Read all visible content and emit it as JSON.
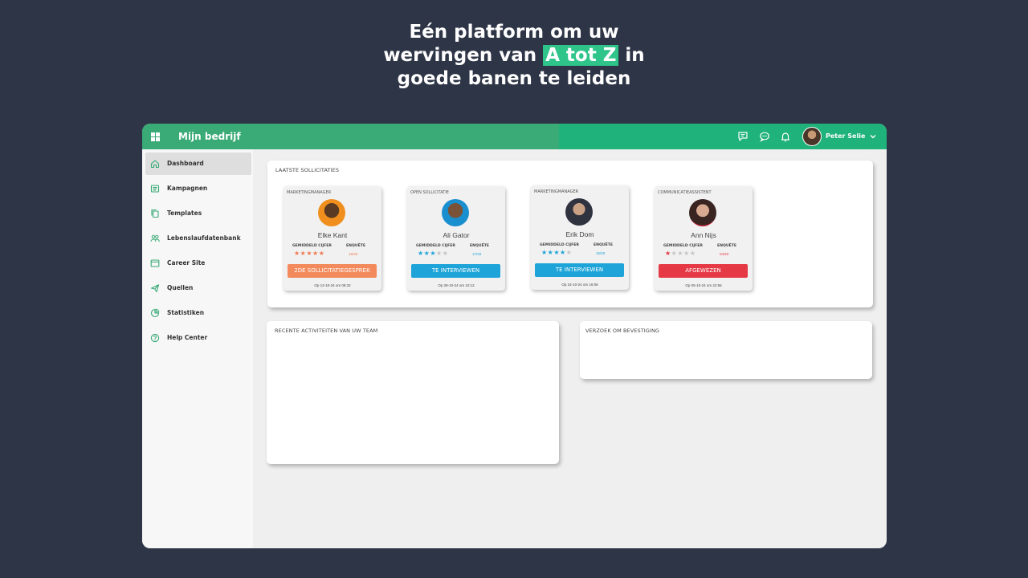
{
  "headline": {
    "line1": "Eén platform om uw",
    "line2_pre": "wervingen van",
    "line2_highlight": "A tot Z",
    "line2_post": "in",
    "line3": "goede banen te leiden",
    "highlight_color": "#2ec48a"
  },
  "topbar": {
    "brand": "Mijn bedrijf",
    "user_name": "Peter Selie",
    "icons": [
      "message-square-icon",
      "chat-bubble-icon",
      "bell-icon",
      "chevron-down-icon"
    ],
    "color": "#3aaa76"
  },
  "sidebar": {
    "items": [
      {
        "label": "Dashboard",
        "icon": "home-icon",
        "active": true
      },
      {
        "label": "Kampagnen",
        "icon": "list-icon"
      },
      {
        "label": "Templates",
        "icon": "copy-icon"
      },
      {
        "label": "Lebenslaufdatenbank",
        "icon": "users-icon"
      },
      {
        "label": "Career Site",
        "icon": "browser-icon"
      },
      {
        "label": "Quellen",
        "icon": "send-icon"
      },
      {
        "label": "Statistiken",
        "icon": "pie-chart-icon"
      },
      {
        "label": "Help Center",
        "icon": "help-circle-icon"
      }
    ]
  },
  "applications": {
    "title": "LAATSTE SOLLICITATIES",
    "col_rating": "GEMIDDELD CIJFER",
    "col_survey": "ENQUÊTE",
    "cards": [
      {
        "role": "MARKETINGMANAGER",
        "name": "Elke Kant",
        "stars": 5,
        "star_color": "#ef7a52",
        "score": "15/20",
        "score_color": "#ef7a52",
        "status": "2DE SOLLICITATIEGESPREK",
        "status_color": "#f28a5c",
        "date": "Op 12-10-24 om 08:32"
      },
      {
        "role": "OPEN SOLLICITATIE",
        "name": "Ali Gator",
        "stars": 3,
        "star_color": "#1ea4d8",
        "score": "17/20",
        "score_color": "#1ea4d8",
        "status": "TE INTERVIEWEN",
        "status_color": "#1ea4d8",
        "date": "Op 28-10-24 om 10:12"
      },
      {
        "role": "MARKETINGMANAGER",
        "name": "Erik Dom",
        "stars": 4,
        "star_color": "#1ea4d8",
        "score": "15/20",
        "score_color": "#1ea4d8",
        "status": "TE INTERVIEWEN",
        "status_color": "#1ea4d8",
        "date": "Op 24-10-24 om 16:06"
      },
      {
        "role": "COMMUNICATIEASSISTENT",
        "name": "Ann Nijs",
        "stars": 1,
        "star_color": "#e53945",
        "score": "04/20",
        "score_color": "#e53945",
        "status": "AFGEWEZEN",
        "status_color": "#e53945",
        "date": "Op 05-10-24 om 22:56"
      }
    ]
  },
  "activities": {
    "title": "RECENTE ACTIVITEITEN VAN UW TEAM"
  },
  "confirmation": {
    "title": "VERZOEK OM BEVESTIGING"
  }
}
